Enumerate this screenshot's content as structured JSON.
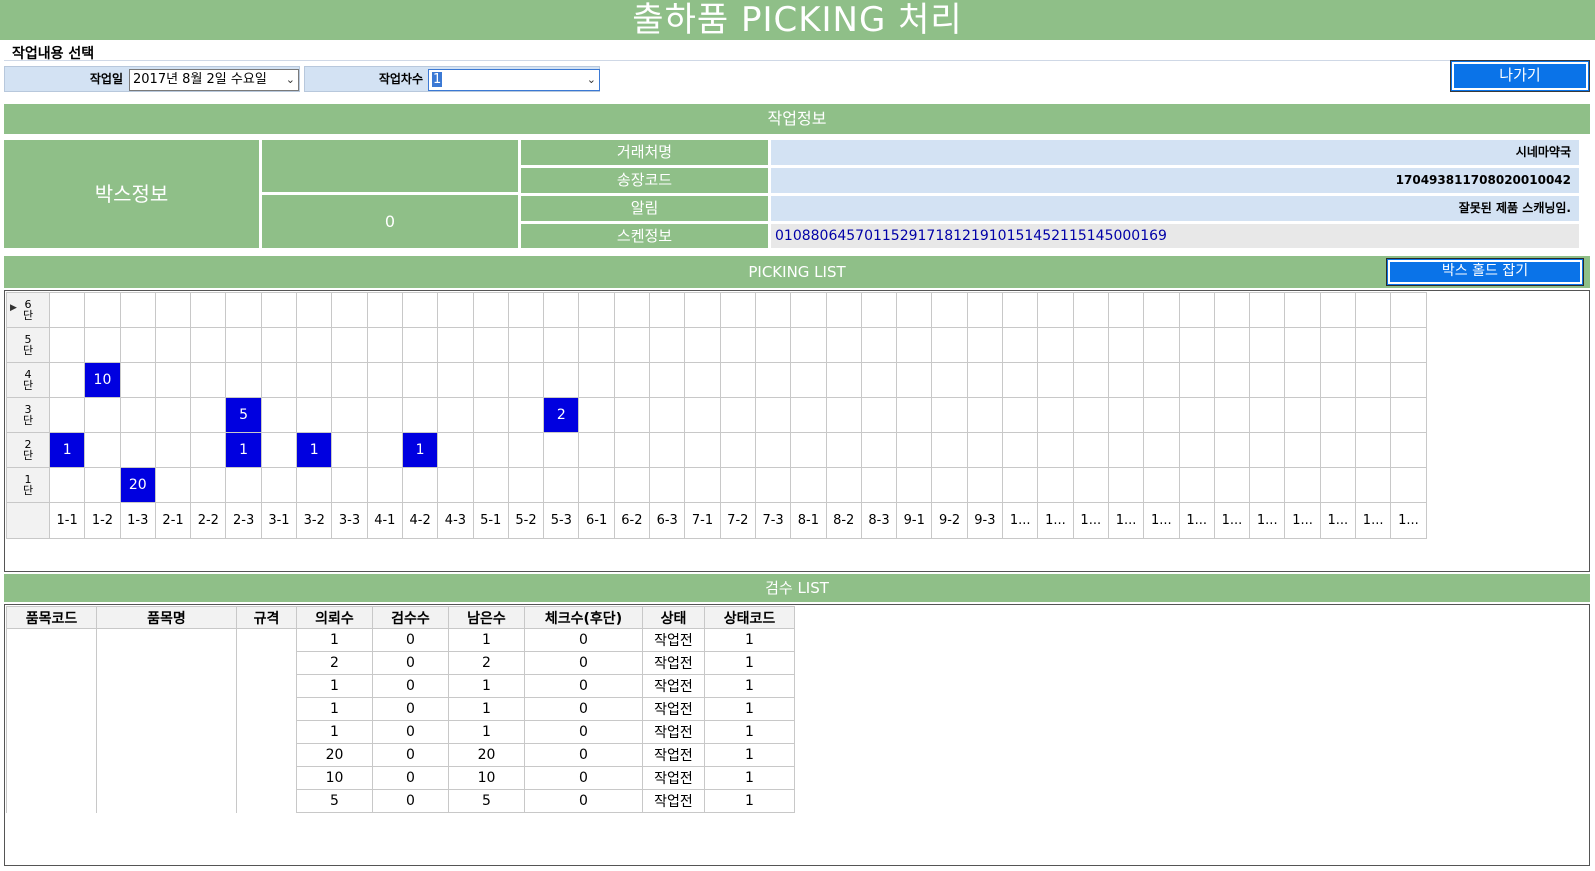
{
  "title": "출하품 PICKING 처리",
  "select_section": {
    "label": "작업내용 선택",
    "work_date_label": "작업일",
    "work_date_value": "2017년   8월   2일 수요일",
    "work_batch_label": "작업차수",
    "work_batch_value": "1",
    "exit_button": "나가기"
  },
  "work_info": {
    "header": "작업정보",
    "box_info_label": "박스정보",
    "box_count": "0",
    "rows": [
      {
        "label": "거래처명",
        "value": "시네마약국"
      },
      {
        "label": "송장코드",
        "value": "17049381170802001004​2"
      },
      {
        "label": "알림",
        "value": "잘못된 제품 스캐닝임."
      },
      {
        "label": "스켄정보",
        "value": "010880645701152917181219101514521151450001​69"
      }
    ]
  },
  "picking": {
    "header": "PICKING LIST",
    "hold_button": "박스 홀드 잡기",
    "row_labels": [
      "6\n단",
      "5\n단",
      "4\n단",
      "3\n단",
      "2\n단",
      "1\n단"
    ],
    "columns": [
      "1-1",
      "1-2",
      "1-3",
      "2-1",
      "2-2",
      "2-3",
      "3-1",
      "3-2",
      "3-3",
      "4-1",
      "4-2",
      "4-3",
      "5-1",
      "5-2",
      "5-3",
      "6-1",
      "6-2",
      "6-3",
      "7-1",
      "7-2",
      "7-3",
      "8-1",
      "8-2",
      "8-3",
      "9-1",
      "9-2",
      "9-3",
      "1...",
      "1...",
      "1...",
      "1...",
      "1...",
      "1...",
      "1...",
      "1...",
      "1...",
      "1...",
      "1...",
      "1..."
    ],
    "cells": [
      {
        "row": 2,
        "col": 1,
        "value": "10"
      },
      {
        "row": 3,
        "col": 5,
        "value": "5"
      },
      {
        "row": 3,
        "col": 14,
        "value": "2"
      },
      {
        "row": 4,
        "col": 0,
        "value": "1"
      },
      {
        "row": 4,
        "col": 5,
        "value": "1"
      },
      {
        "row": 4,
        "col": 7,
        "value": "1"
      },
      {
        "row": 4,
        "col": 10,
        "value": "1"
      },
      {
        "row": 5,
        "col": 2,
        "value": "20"
      }
    ]
  },
  "inspection": {
    "header": "검수 LIST",
    "columns": [
      "품목코드",
      "품목명",
      "규격",
      "의뢰수",
      "검수수",
      "남은수",
      "체크수(후단)",
      "상태",
      "상태코드"
    ],
    "rows": [
      [
        "1",
        "0",
        "1",
        "0",
        "작업전",
        "1"
      ],
      [
        "2",
        "0",
        "2",
        "0",
        "작업전",
        "1"
      ],
      [
        "1",
        "0",
        "1",
        "0",
        "작업전",
        "1"
      ],
      [
        "1",
        "0",
        "1",
        "0",
        "작업전",
        "1"
      ],
      [
        "1",
        "0",
        "1",
        "0",
        "작업전",
        "1"
      ],
      [
        "20",
        "0",
        "20",
        "0",
        "작업전",
        "1"
      ],
      [
        "10",
        "0",
        "10",
        "0",
        "작업전",
        "1"
      ],
      [
        "5",
        "0",
        "5",
        "0",
        "작업전",
        "1"
      ]
    ]
  }
}
